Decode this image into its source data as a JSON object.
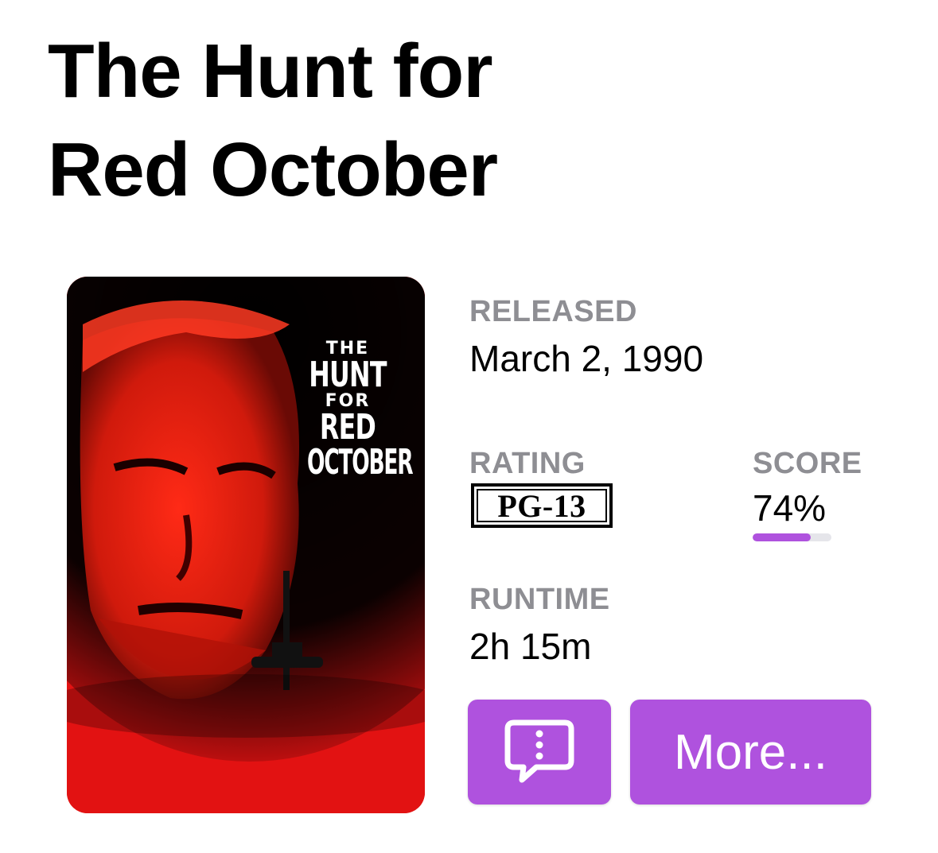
{
  "movie": {
    "title": "The Hunt for Red October",
    "poster": {
      "line1": "THE",
      "line2": "HUNT",
      "line3": "FOR",
      "line4": "RED",
      "line5": "OCTOBER"
    }
  },
  "details": {
    "released_label": "RELEASED",
    "released_value": "March 2, 1990",
    "rating_label": "RATING",
    "rating_value": "PG-13",
    "score_label": "SCORE",
    "score_value": "74%",
    "score_fraction": 0.74,
    "runtime_label": "RUNTIME",
    "runtime_value": "2h 15m"
  },
  "actions": {
    "comment_icon": "comment-dots-icon",
    "more_label": "More..."
  },
  "colors": {
    "accent": "#af52de",
    "label_gray": "#8e8e93",
    "poster_red": "#e21212"
  }
}
